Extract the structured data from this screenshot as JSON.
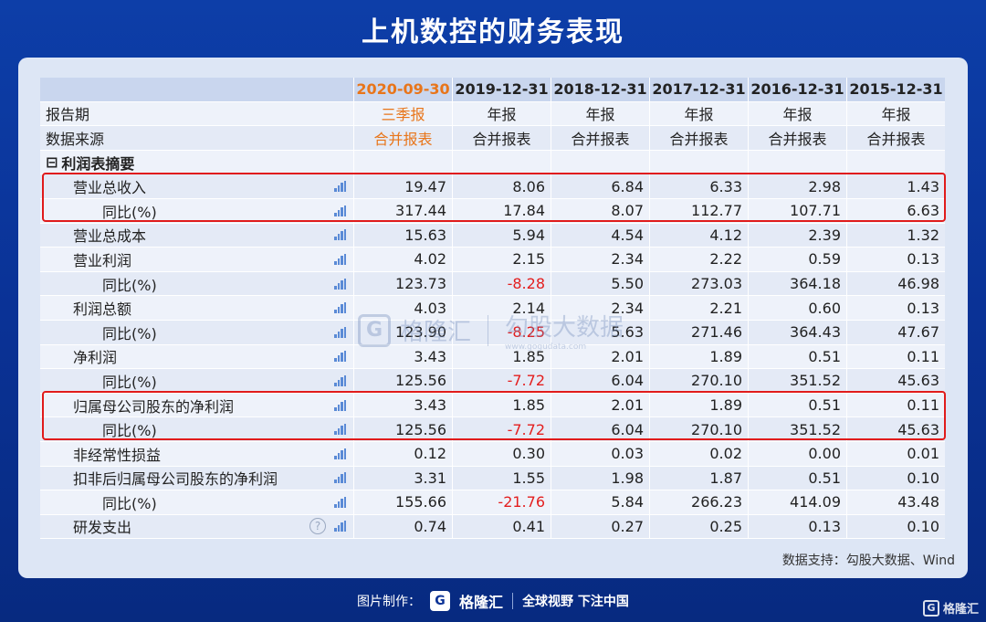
{
  "title": "上机数控的财务表现",
  "columns": [
    "2020-09-30",
    "2019-12-31",
    "2018-12-31",
    "2017-12-31",
    "2016-12-31",
    "2015-12-31"
  ],
  "meta_rows": [
    {
      "label": "报告期",
      "values": [
        "三季报",
        "年报",
        "年报",
        "年报",
        "年报",
        "年报"
      ]
    },
    {
      "label": "数据来源",
      "values": [
        "合并报表",
        "合并报表",
        "合并报表",
        "合并报表",
        "合并报表",
        "合并报表"
      ]
    }
  ],
  "section_label": "利润表摘要",
  "section_toggle": "⊟",
  "rows": [
    {
      "label": "营业总收入",
      "values": [
        "19.47",
        "8.06",
        "6.84",
        "6.33",
        "2.98",
        "1.43"
      ]
    },
    {
      "label": "同比(%)",
      "values": [
        "317.44",
        "17.84",
        "8.07",
        "112.77",
        "107.71",
        "6.63"
      ]
    },
    {
      "label": "营业总成本",
      "values": [
        "15.63",
        "5.94",
        "4.54",
        "4.12",
        "2.39",
        "1.32"
      ]
    },
    {
      "label": "营业利润",
      "values": [
        "4.02",
        "2.15",
        "2.34",
        "2.22",
        "0.59",
        "0.13"
      ]
    },
    {
      "label": "同比(%)",
      "values": [
        "123.73",
        "-8.28",
        "5.50",
        "273.03",
        "364.18",
        "46.98"
      ]
    },
    {
      "label": "利润总额",
      "values": [
        "4.03",
        "2.14",
        "2.34",
        "2.21",
        "0.60",
        "0.13"
      ]
    },
    {
      "label": "同比(%)",
      "values": [
        "123.90",
        "-8.25",
        "5.63",
        "271.46",
        "364.43",
        "47.67"
      ]
    },
    {
      "label": "净利润",
      "values": [
        "3.43",
        "1.85",
        "2.01",
        "1.89",
        "0.51",
        "0.11"
      ]
    },
    {
      "label": "同比(%)",
      "values": [
        "125.56",
        "-7.72",
        "6.04",
        "270.10",
        "351.52",
        "45.63"
      ]
    },
    {
      "label": "归属母公司股东的净利润",
      "values": [
        "3.43",
        "1.85",
        "2.01",
        "1.89",
        "0.51",
        "0.11"
      ]
    },
    {
      "label": "同比(%)",
      "values": [
        "125.56",
        "-7.72",
        "6.04",
        "270.10",
        "351.52",
        "45.63"
      ]
    },
    {
      "label": "非经常性损益",
      "values": [
        "0.12",
        "0.30",
        "0.03",
        "0.02",
        "0.00",
        "0.01"
      ]
    },
    {
      "label": "扣非后归属母公司股东的净利润",
      "values": [
        "3.31",
        "1.55",
        "1.98",
        "1.87",
        "0.51",
        "0.10"
      ]
    },
    {
      "label": "同比(%)",
      "values": [
        "155.66",
        "-21.76",
        "5.84",
        "266.23",
        "414.09",
        "43.48"
      ]
    },
    {
      "label": "研发支出",
      "values": [
        "0.74",
        "0.41",
        "0.27",
        "0.25",
        "0.13",
        "0.10"
      ]
    }
  ],
  "help_glyph": "?",
  "support_text": "数据支持：勾股大数据、Wind",
  "watermark": {
    "logo_glyph": "G",
    "brand": "格隆汇",
    "brand2": "勾股大数据",
    "sub": "www.gogudata.com"
  },
  "footer": {
    "made_by": "图片制作：",
    "logo_glyph": "G",
    "brand": "格隆汇",
    "slogan": "全球视野 下注中国"
  },
  "corner": {
    "logo_glyph": "G",
    "brand": "格隆汇"
  },
  "colors": {
    "accent_orange": "#e8751a",
    "negative_red": "#e31e1e",
    "highlight_box": "#e01b1b",
    "bg_blue": "#0a3296"
  }
}
